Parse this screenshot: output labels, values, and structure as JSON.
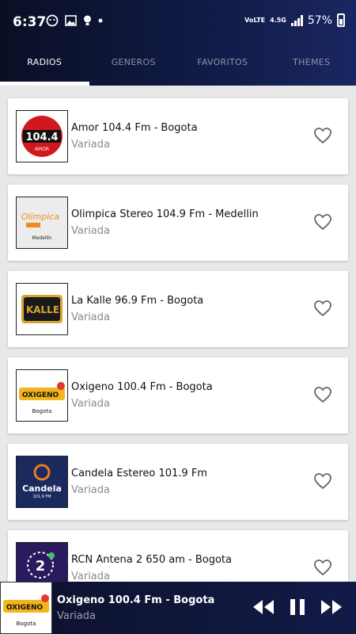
{
  "status_bar": {
    "time": "6:37",
    "network": "VoLTE",
    "network_speed": "4.5G",
    "battery": "57%"
  },
  "tabs": [
    {
      "label": "RADIOS",
      "active": true
    },
    {
      "label": "GENEROS",
      "active": false
    },
    {
      "label": "FAVORITOS",
      "active": false
    },
    {
      "label": "THEMES",
      "active": false
    }
  ],
  "stations": [
    {
      "title": "Amor 104.4 Fm - Bogota",
      "genre": "Variada",
      "logo_text": "104.4",
      "logo_sub": "AMOR"
    },
    {
      "title": "Olimpica Stereo 104.9 Fm - Medellin",
      "genre": "Variada",
      "logo_text": "Olimpica",
      "logo_sub": "Medellín"
    },
    {
      "title": "La Kalle 96.9 Fm - Bogota",
      "genre": "Variada",
      "logo_text": "KALLE"
    },
    {
      "title": "Oxigeno 100.4 Fm - Bogota",
      "genre": "Variada",
      "logo_text": "OXIGENO",
      "logo_sub": "Bogota"
    },
    {
      "title": "Candela Estereo 101.9 Fm",
      "genre": "Variada",
      "logo_text": "Candela",
      "logo_sub": "101.9 FM"
    },
    {
      "title": "RCN Antena 2 650 am - Bogota",
      "genre": "Variada",
      "logo_text": "2"
    }
  ],
  "player": {
    "title": "Oxigeno 100.4 Fm - Bogota",
    "subtitle": "Variada",
    "logo_text": "OXIGENO",
    "logo_sub": "Bogota"
  },
  "colors": {
    "header_dark": "#0a0f24",
    "header_light": "#1a2660",
    "amor_red": "#d0181e",
    "olimpica_orange": "#f18a1e",
    "candela_blue": "#1b2a5e",
    "rcn_purple": "#2a1a5e"
  }
}
